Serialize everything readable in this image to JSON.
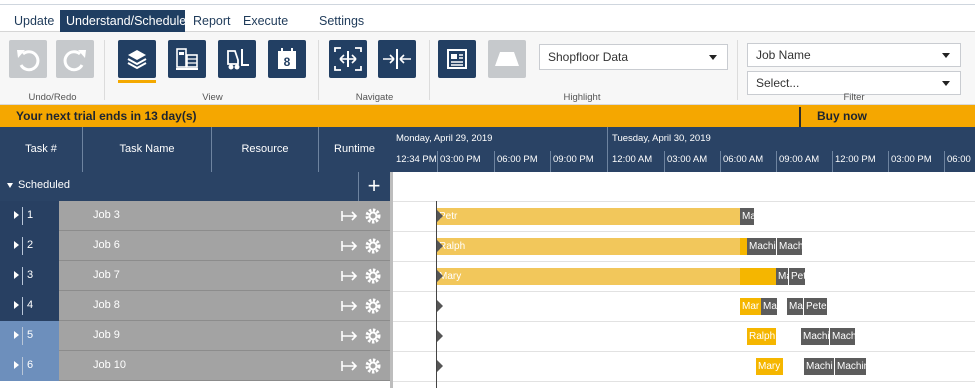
{
  "menu": {
    "tabs": [
      {
        "label": "Update"
      },
      {
        "label": "Understand/Schedule"
      },
      {
        "label": "Report"
      },
      {
        "label": "Execute"
      },
      {
        "label": "Settings"
      }
    ],
    "active_tab": "Understand/Schedule"
  },
  "ribbon": {
    "groups": {
      "undo_redo": "Undo/Redo",
      "view": "View",
      "navigate": "Navigate",
      "highlight": "Highlight",
      "filter": "Filter"
    },
    "calendar_day": "8",
    "highlight_select": "Shopfloor Data",
    "filter_field_select": "Job Name",
    "filter_value_select": "Select..."
  },
  "trial": {
    "message": "Your next trial ends in 13 day(s)",
    "buy_label": "Buy now"
  },
  "grid": {
    "columns": {
      "task_num": "Task #",
      "task_name": "Task Name",
      "resource": "Resource",
      "runtime": "Runtime"
    },
    "group_label": "Scheduled",
    "add_label": "+",
    "rows": [
      {
        "num": "1",
        "name": "Job 3"
      },
      {
        "num": "2",
        "name": "Job 6"
      },
      {
        "num": "3",
        "name": "Job 7"
      },
      {
        "num": "4",
        "name": "Job 8"
      },
      {
        "num": "5",
        "name": "Job 9"
      },
      {
        "num": "6",
        "name": "Job 10"
      }
    ]
  },
  "gantt": {
    "dates": [
      "Monday, April 29, 2019",
      "Tuesday, April 30, 2019"
    ],
    "hours": [
      "12:34 PM",
      "03:00 PM",
      "06:00 PM",
      "09:00 PM",
      "12:00 AM",
      "03:00 AM",
      "06:00 AM",
      "09:00 AM",
      "12:00 PM",
      "03:00 PM",
      "06:00"
    ],
    "bar_labels": {
      "row1": [
        "Petr",
        "Ma"
      ],
      "row2": [
        "Ralph",
        "Machi",
        "Mach"
      ],
      "row3": [
        "Mary",
        "Ma",
        "Pet"
      ],
      "row4": [
        "Mar",
        "Ma",
        "Ma",
        "Peter"
      ],
      "row5": [
        "Ralph",
        "Machi",
        "Mach"
      ],
      "row6": [
        "Mary",
        "Machi",
        "Machin"
      ]
    }
  },
  "colors": {
    "navy": "#2a4365",
    "accent_orange": "#f5a700",
    "bar_yellow": "#f2c75b",
    "bar_gray": "#5c5c5c"
  }
}
